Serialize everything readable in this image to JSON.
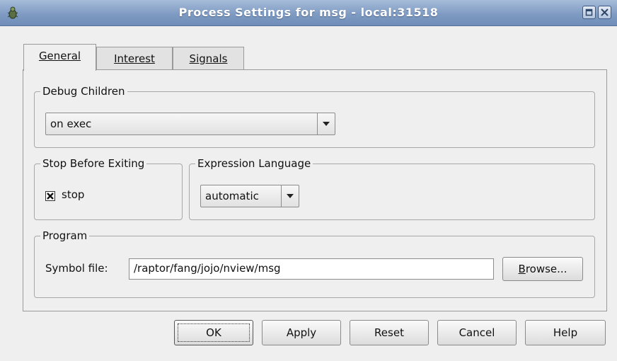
{
  "window": {
    "title": "Process Settings for msg - local:31518"
  },
  "tabs": [
    {
      "label": "General",
      "active": true
    },
    {
      "label": "Interest",
      "active": false
    },
    {
      "label": "Signals",
      "active": false
    }
  ],
  "debug_children": {
    "legend": "Debug Children",
    "selected": "on exec"
  },
  "stop_before_exiting": {
    "legend": "Stop Before Exiting",
    "checkbox_label": "stop",
    "checked": true
  },
  "expression_language": {
    "legend": "Expression Language",
    "selected": "automatic"
  },
  "program": {
    "legend": "Program",
    "symbol_label": "Symbol file:",
    "symbol_value": "/raptor/fang/jojo/nview/msg",
    "browse_pre": "B",
    "browse_rest": "rowse..."
  },
  "buttons": {
    "ok": "OK",
    "apply": "Apply",
    "reset": "Reset",
    "cancel": "Cancel",
    "help": "Help"
  },
  "colors": {
    "titlebar": "#7f9bc3",
    "window_bg": "#efefef"
  },
  "icons": {
    "app": "bug-icon",
    "maximize": "maximize-icon",
    "close": "close-icon",
    "combo_arrow": "chevron-down-icon",
    "check": "x-mark-icon"
  }
}
